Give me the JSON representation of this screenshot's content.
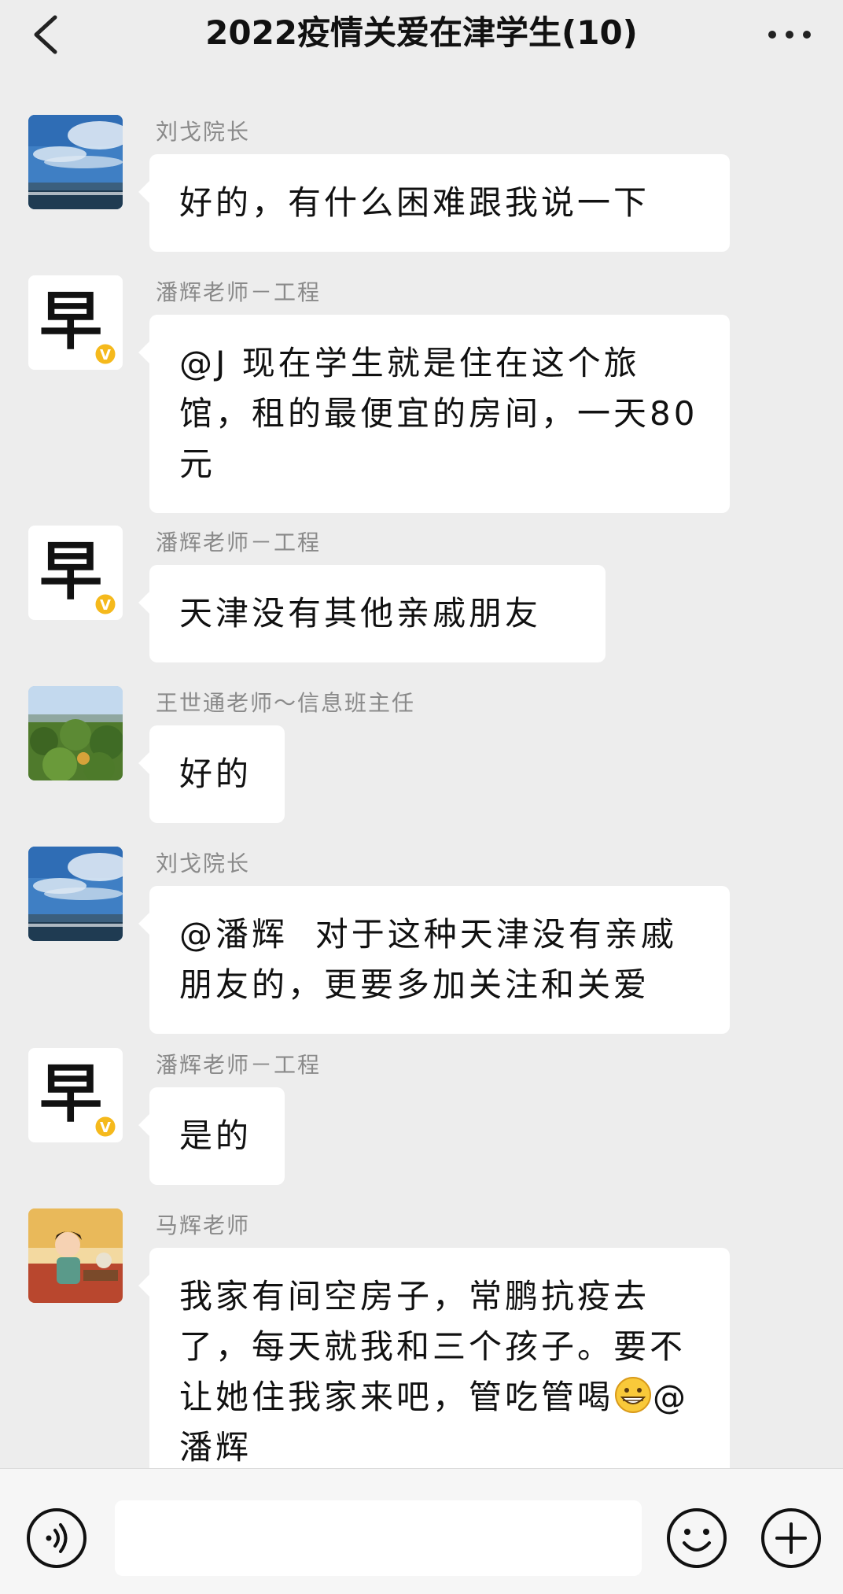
{
  "header": {
    "title": "2022疫情关爱在津学生(10)",
    "back_icon": "chevron-left-icon",
    "more_icon": "more-dots-icon"
  },
  "messages": [
    {
      "sender": "刘戈院长",
      "avatar": "sky-sea-photo",
      "text": "好的，有什么困难跟我说一下"
    },
    {
      "sender": "潘辉老师－工程",
      "avatar": "calligraphy-zao-verified",
      "text": "@J 现在学生就是住在这个旅馆，租的最便宜的房间，一天80元"
    },
    {
      "sender": "潘辉老师－工程",
      "avatar": "calligraphy-zao-verified",
      "text": "天津没有其他亲戚朋友"
    },
    {
      "sender": "王世通老师～信息班主任",
      "avatar": "trees-landscape-photo",
      "text": "好的"
    },
    {
      "sender": "刘戈院长",
      "avatar": "sky-sea-photo",
      "text": "@潘辉  对于这种天津没有亲戚朋友的，更要多加关注和关爱"
    },
    {
      "sender": "潘辉老师－工程",
      "avatar": "calligraphy-zao-verified",
      "text": "是的"
    },
    {
      "sender": "马辉老师",
      "avatar": "cartoon-illustration",
      "text": "我家有间空房子，常鹏抗疫去了，每天就我和三个孩子。要不让她住我家来吧，管吃管喝",
      "text_after_emoji": "@潘辉",
      "emoji": "grinning-face-emoji"
    }
  ],
  "input_bar": {
    "voice_icon": "voice-icon",
    "input_value": "",
    "emoji_icon": "smiley-icon",
    "plus_icon": "plus-icon"
  },
  "colors": {
    "background": "#ededed",
    "bubble": "#ffffff",
    "sender_text": "#8a8a8a",
    "verified_badge": "#f5b91c"
  }
}
